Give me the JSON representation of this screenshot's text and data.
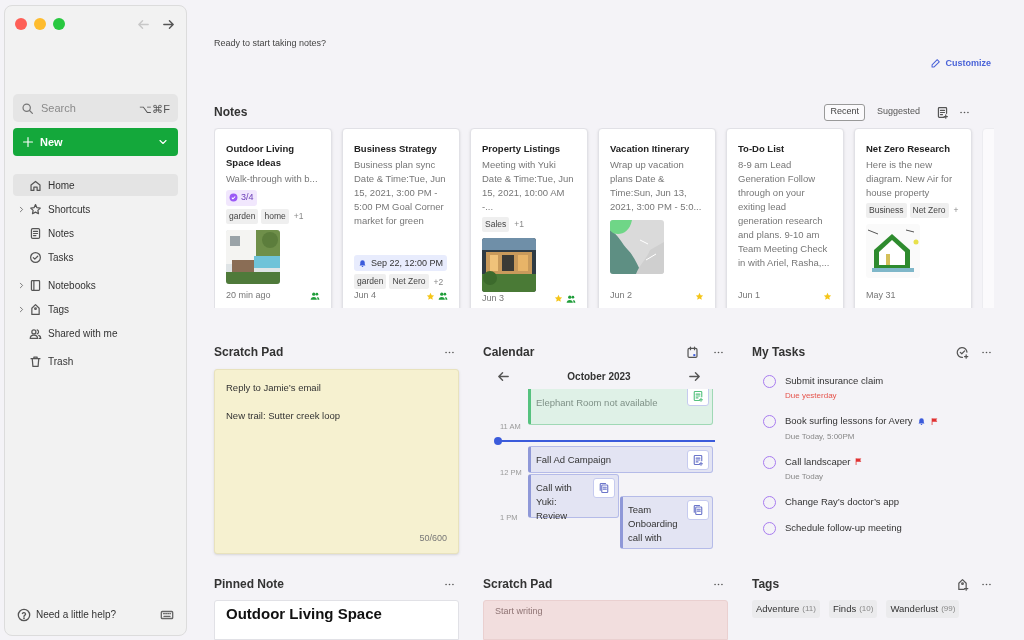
{
  "nav": {
    "back_enabled": false,
    "forward_enabled": true
  },
  "sidebar": {
    "search": {
      "placeholder": "Search",
      "shortcut": "⌥⌘F"
    },
    "new_button": "New",
    "nav_groups": [
      [
        {
          "label": "Home",
          "selected": true,
          "expandable": false
        },
        {
          "label": "Shortcuts",
          "selected": false,
          "expandable": true
        },
        {
          "label": "Notes",
          "selected": false,
          "expandable": false
        },
        {
          "label": "Tasks",
          "selected": false,
          "expandable": false
        }
      ],
      [
        {
          "label": "Notebooks",
          "selected": false,
          "expandable": true
        },
        {
          "label": "Tags",
          "selected": false,
          "expandable": true
        },
        {
          "label": "Shared with me",
          "selected": false,
          "expandable": false
        }
      ],
      [
        {
          "label": "Trash",
          "selected": false,
          "expandable": false
        }
      ]
    ],
    "help": "Need a little help?"
  },
  "greeting": "Ready to start taking notes?",
  "customize": "Customize",
  "notes": {
    "title": "Notes",
    "tabs": [
      {
        "label": "Recent",
        "selected": true
      },
      {
        "label": "Suggested",
        "selected": false
      }
    ],
    "cards": [
      {
        "title": "Outdoor Living Space Ideas",
        "snippet": "Walk-through with b...",
        "tasks": "3/4",
        "tags": [
          "garden",
          "home"
        ],
        "more": "+1",
        "thumbnail": {
          "kind": "picture"
        },
        "date": "20 min ago",
        "starred": false,
        "shared": true
      },
      {
        "title": "Business Strategy",
        "snippet": "Business plan sync Date & Time:Tue, Jun 15, 2021, 3:00 PM - 5:00 PM Goal Corner market for green",
        "reminder": "Sep 22, 12:00 PM",
        "tags": [
          "garden",
          "Net Zero"
        ],
        "more": "+2",
        "date": "Jun 4",
        "starred": true,
        "shared": true
      },
      {
        "title": "Property Listings",
        "snippet": "Meeting with Yuki Date & Time:Tue, Jun 15, 2021, 10:00 AM -...",
        "tags": [
          "Sales"
        ],
        "more": "+1",
        "thumbnail": {
          "kind": "picture"
        },
        "date": "Jun 3",
        "starred": true,
        "shared": true
      },
      {
        "title": "Vacation Itinerary",
        "snippet": "Wrap up vacation plans Date & Time:Sun, Jun 13, 2021, 3:00 PM - 5:0...",
        "thumbnail": {
          "kind": "picture"
        },
        "date": "Jun 2",
        "starred": true,
        "shared": false
      },
      {
        "title": "To-Do List",
        "snippet": "8-9 am Lead Generation Follow through on your exiting lead generation research and plans. 9-10 am Team Meeting Check in with Ariel, Rasha,...",
        "date": "Jun 1",
        "starred": true,
        "shared": false
      },
      {
        "title": "Net Zero Research",
        "snippet": "Here is the new diagram. New Air for house property",
        "tags": [
          "Business",
          "Net Zero"
        ],
        "more": "+",
        "thumbnail": {
          "kind": "picture"
        },
        "date": "May 31",
        "starred": false,
        "shared": false
      }
    ]
  },
  "scratch_pad": {
    "title": "Scratch Pad",
    "lines": [
      "Reply to Jamie’s email",
      "New trail: Sutter creek loop"
    ],
    "counter": "50/600"
  },
  "calendar": {
    "title": "Calendar",
    "month": "October 2023",
    "hours": [
      "11 AM",
      "12 PM",
      "1 PM"
    ],
    "events": [
      {
        "title": "Elephant Room not available",
        "kind": "unavailable"
      },
      {
        "title": "Fall Ad Campaign",
        "kind": "event"
      },
      {
        "title": "Call with Yuki: Review",
        "kind": "event"
      },
      {
        "title": "Team Onboarding call with",
        "kind": "event"
      }
    ]
  },
  "my_tasks": {
    "title": "My Tasks",
    "items": [
      {
        "title": "Submit insurance claim",
        "due": "Due yesterday",
        "overdue": true,
        "reminder": false,
        "flagged": false,
        "checked": false
      },
      {
        "title": "Book surfing lessons for Avery",
        "due": "Due Today, 5:00PM",
        "overdue": false,
        "reminder": true,
        "flagged": true,
        "checked": false
      },
      {
        "title": "Call landscaper",
        "due": "Due Today",
        "overdue": false,
        "reminder": false,
        "flagged": true,
        "checked": false
      },
      {
        "title": "Change Ray’s doctor’s app",
        "reminder": false,
        "flagged": false,
        "checked": false
      },
      {
        "title": "Schedule follow-up meeting",
        "reminder": false,
        "flagged": false,
        "checked": false
      }
    ]
  },
  "pinned_note": {
    "title": "Pinned Note",
    "note_title": "Outdoor Living Space"
  },
  "scratch_pad_2": {
    "title": "Scratch Pad",
    "placeholder": "Start writing"
  },
  "tags": {
    "title": "Tags",
    "items": [
      {
        "name": "Adventure",
        "count": "(11)"
      },
      {
        "name": "Finds",
        "count": "(10)"
      },
      {
        "name": "Wanderlust",
        "count": "(99)"
      }
    ]
  }
}
